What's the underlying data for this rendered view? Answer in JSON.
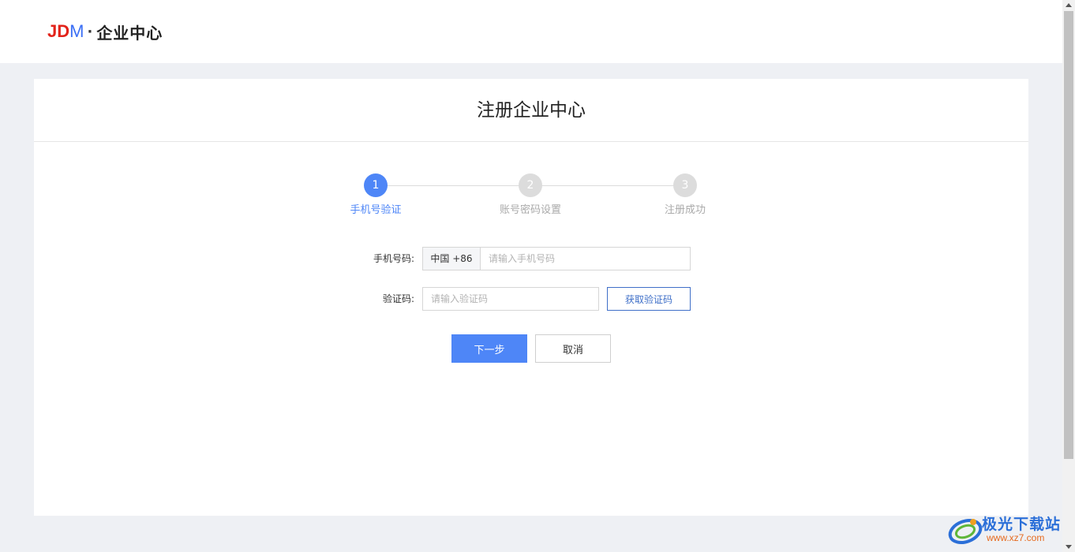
{
  "header": {
    "logo": {
      "j": "J",
      "d": "D",
      "m": "M",
      "dot": "·",
      "name": "企业中心"
    }
  },
  "card": {
    "title": "注册企业中心"
  },
  "steps": [
    {
      "number": "1",
      "label": "手机号验证",
      "active": true
    },
    {
      "number": "2",
      "label": "账号密码设置",
      "active": false
    },
    {
      "number": "3",
      "label": "注册成功",
      "active": false
    }
  ],
  "form": {
    "phone_label": "手机号码:",
    "country_code": "中国 +86",
    "phone_placeholder": "请输入手机号码",
    "code_label": "验证码:",
    "code_placeholder": "请输入验证码",
    "get_code_label": "获取验证码"
  },
  "actions": {
    "next_label": "下一步",
    "cancel_label": "取消"
  },
  "watermark": {
    "name": "极光下载站",
    "url": "www.xz7.com"
  },
  "colors": {
    "accent": "#4e86f7",
    "logo_red": "#e2231a",
    "logo_blue": "#3b6ff5",
    "page_bg": "#eef0f4"
  }
}
